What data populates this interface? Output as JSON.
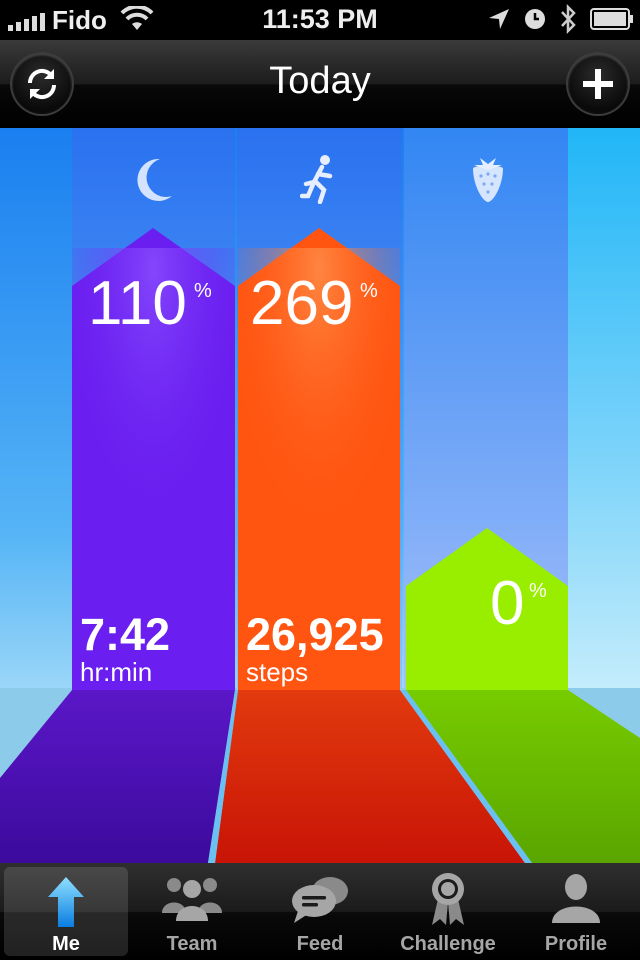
{
  "status_bar": {
    "carrier": "Fido",
    "time": "11:53 PM"
  },
  "nav": {
    "title": "Today",
    "left_icon": "refresh-icon",
    "right_icon": "plus-icon"
  },
  "dashboard": {
    "sleep": {
      "icon": "moon-icon",
      "percent": "110",
      "percent_sign": "%",
      "value": "7:42",
      "unit": "hr:min",
      "color": "#6a1ef0",
      "progress_percent": 110
    },
    "move": {
      "icon": "runner-icon",
      "percent": "269",
      "percent_sign": "%",
      "value": "26,925",
      "unit": "steps",
      "color": "#ff5511",
      "progress_percent": 269
    },
    "eat": {
      "icon": "strawberry-icon",
      "percent": "0",
      "percent_sign": "%",
      "color": "#99ee00",
      "progress_percent": 0
    }
  },
  "tabs": [
    {
      "label": "Me",
      "icon": "up-arrow-icon",
      "selected": true
    },
    {
      "label": "Team",
      "icon": "team-icon",
      "selected": false
    },
    {
      "label": "Feed",
      "icon": "speech-bubbles-icon",
      "selected": false
    },
    {
      "label": "Challenge",
      "icon": "award-ribbon-icon",
      "selected": false
    },
    {
      "label": "Profile",
      "icon": "person-icon",
      "selected": false
    }
  ]
}
